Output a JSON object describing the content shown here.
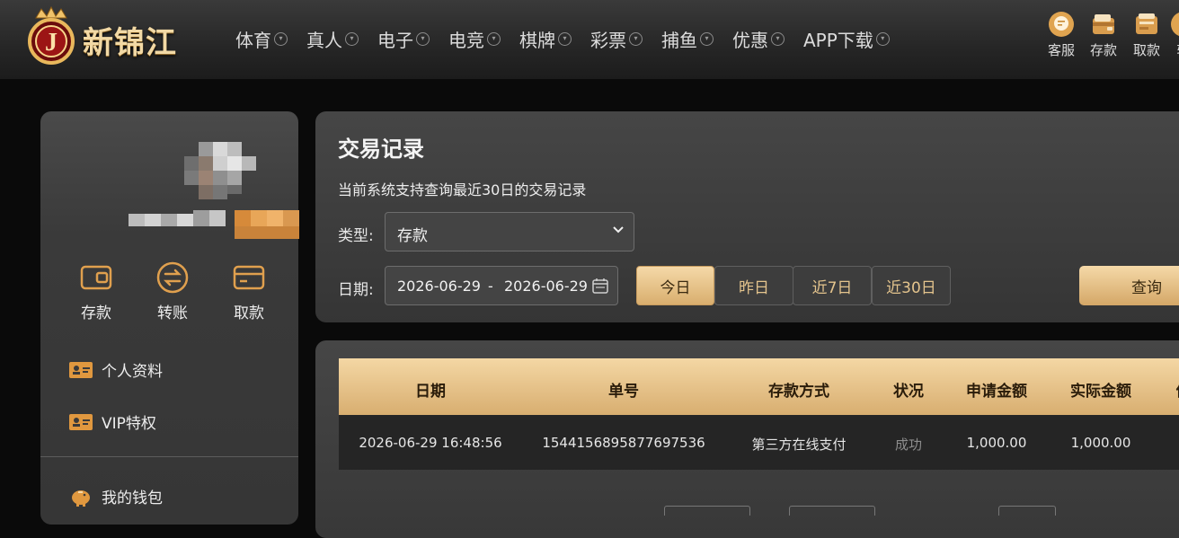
{
  "header": {
    "logo_text": "新锦江",
    "logo_letter": "J",
    "nav": [
      {
        "label": "体育"
      },
      {
        "label": "真人"
      },
      {
        "label": "电子"
      },
      {
        "label": "电竞"
      },
      {
        "label": "棋牌"
      },
      {
        "label": "彩票"
      },
      {
        "label": "捕鱼"
      },
      {
        "label": "优惠"
      },
      {
        "label": "APP下载"
      }
    ],
    "quick_links": [
      {
        "label": "客服",
        "icon": "customer-service-icon"
      },
      {
        "label": "存款",
        "icon": "deposit-wallet-icon"
      },
      {
        "label": "取款",
        "icon": "withdraw-atm-icon"
      },
      {
        "label": "转",
        "icon": "transfer-icon"
      }
    ]
  },
  "sidebar": {
    "actions": [
      {
        "label": "存款",
        "icon": "wallet-icon"
      },
      {
        "label": "转账",
        "icon": "transfer-circle-icon"
      },
      {
        "label": "取款",
        "icon": "card-icon"
      }
    ],
    "menu": [
      {
        "label": "个人资料",
        "icon": "id-card-icon"
      },
      {
        "label": "VIP特权",
        "icon": "vip-card-icon"
      },
      {
        "label": "我的钱包",
        "icon": "piggy-bank-icon"
      }
    ]
  },
  "filter": {
    "title": "交易记录",
    "subtitle": "当前系统支持查询最近30日的交易记录",
    "type_label": "类型:",
    "type_value": "存款",
    "date_label": "日期:",
    "date_start": "2026-06-29",
    "date_sep": "-",
    "date_end": "2026-06-29",
    "quick_ranges": [
      {
        "label": "今日",
        "active": true
      },
      {
        "label": "昨日",
        "active": false
      },
      {
        "label": "近7日",
        "active": false
      },
      {
        "label": "近30日",
        "active": false
      }
    ],
    "search_label": "查询"
  },
  "table": {
    "headers": [
      "日期",
      "单号",
      "存款方式",
      "状况",
      "申请金额",
      "实际金额",
      "优"
    ],
    "rows": [
      [
        "2026-06-29 16:48:56",
        "1544156895877697536",
        "第三方在线支付",
        "成功",
        "1,000.00",
        "1,000.00",
        ""
      ]
    ]
  },
  "colors": {
    "gold_light": "#f5d9a8",
    "gold_dark": "#d4a767",
    "panel": "#3a3a3a",
    "success_text": "#8d8d8d"
  }
}
